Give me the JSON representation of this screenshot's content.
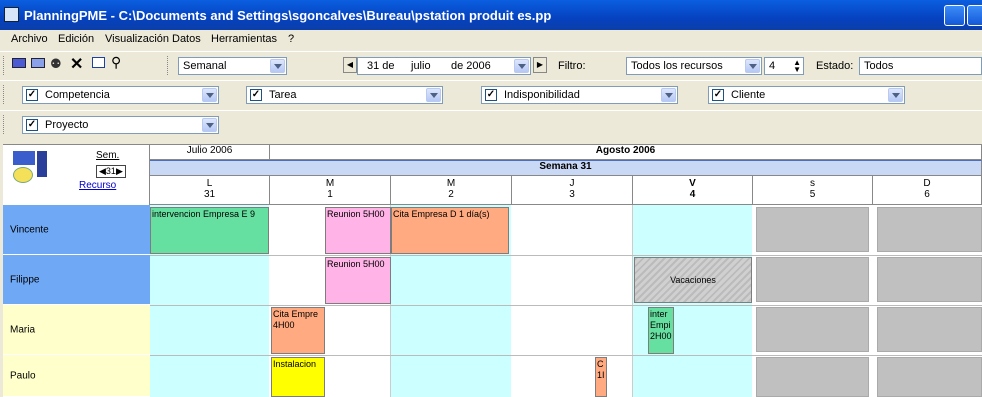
{
  "window": {
    "title": "PlanningPME - C:\\Documents and Settings\\sgoncalves\\Bureau\\pstation produit es.pp"
  },
  "menu": [
    "Archivo",
    "Edición",
    "Visualización",
    "Datos",
    "Herramientas",
    "?"
  ],
  "toolbar": {
    "view_select": "Semanal",
    "day_value": "31 de",
    "month_value": "julio",
    "year_value": "de 2006",
    "filter_label": "Filtro:",
    "filter_select": "Todos los recursos",
    "count_value": "4",
    "state_label": "Estado:",
    "state_value": "Todos"
  },
  "filters": {
    "competencia": "Competencia",
    "tarea": "Tarea",
    "indisponibilidad": "Indisponibilidad",
    "cliente": "Cliente",
    "proyecto": "Proyecto"
  },
  "grid": {
    "sem_label": "Sem.",
    "week_nav": "31",
    "resource_link": "Recurso",
    "month_prev": "Julio 2006",
    "month_curr": "Agosto 2006",
    "week_label": "Semana 31",
    "days": [
      {
        "letter": "L",
        "num": "31"
      },
      {
        "letter": "M",
        "num": "1"
      },
      {
        "letter": "M",
        "num": "2"
      },
      {
        "letter": "J",
        "num": "3"
      },
      {
        "letter": "V",
        "num": "4"
      },
      {
        "letter": "s",
        "num": "5"
      },
      {
        "letter": "D",
        "num": "6"
      }
    ],
    "resources": [
      "Vincente",
      "Filippe",
      "Maria",
      "Paulo"
    ],
    "tasks": {
      "t1": "intervencion Empresa E 9",
      "t2": "Reunion 5H00",
      "t3": "Cita Empresa D  1 día(s)",
      "t4": "Reunion 5H00",
      "t5": "Vacaciones",
      "t6a": "Cita Empre",
      "t6b": "4H00",
      "t7a": "inter",
      "t7b": "Empi",
      "t7c": "2H00",
      "t8": "Instalacion",
      "t9a": "C",
      "t9b": "1I"
    }
  },
  "colors": {
    "resource_blue": "#6FA8F5",
    "resource_yellow": "#FFFFCC",
    "weekday_bg": "#CCFFFF",
    "weekend_bg": "#C0C0C0",
    "task_green": "#66E0A0",
    "task_pink": "#FFB3E6",
    "task_orange": "#FFAA80",
    "task_yellow": "#FFFF00",
    "week_band": "#C9D9F5"
  }
}
